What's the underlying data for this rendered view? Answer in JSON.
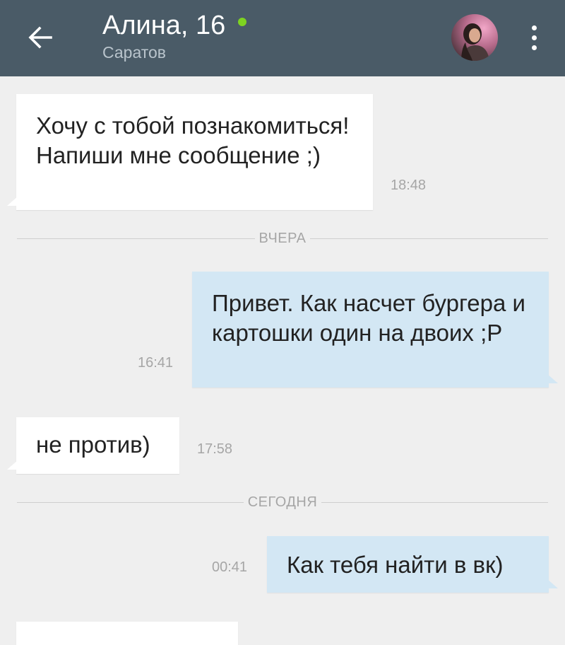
{
  "header": {
    "back_icon": "arrow-left-icon",
    "name": "Алина, 16",
    "status": "online",
    "status_color": "#7ed321",
    "location": "Саратов",
    "menu_icon": "more-vertical-icon",
    "bar_color": "#4a5b67"
  },
  "dividers": {
    "yesterday": "ВЧЕРА",
    "today": "СЕГОДНЯ"
  },
  "messages": [
    {
      "direction": "in",
      "text": "Хочу с тобой познакомиться! Напиши мне сообщение ;)",
      "time": "18:48"
    },
    {
      "direction": "out",
      "text": "Привет. Как насчет бургера и картошки один на двоих ;P",
      "time": "16:41"
    },
    {
      "direction": "in",
      "text": "не против)",
      "time": "17:58"
    },
    {
      "direction": "out",
      "text": "Как тебя найти в вк)",
      "time": "00:41"
    },
    {
      "direction": "in",
      "text": "",
      "time": ""
    }
  ],
  "colors": {
    "incoming_bubble": "#ffffff",
    "outgoing_bubble": "#d3e7f4",
    "background": "#efefef"
  }
}
